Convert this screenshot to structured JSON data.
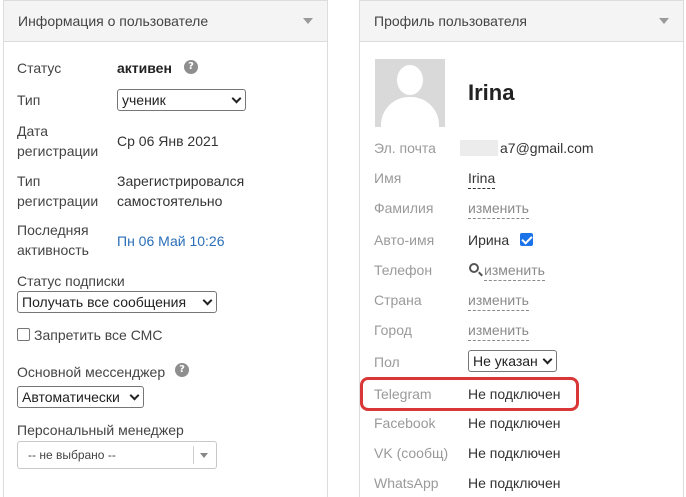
{
  "user_info": {
    "title": "Информация о пользователе",
    "status_label": "Статус",
    "status_value": "активен",
    "type_label": "Тип",
    "type_value": "ученик",
    "reg_date_label_1": "Дата",
    "reg_date_label_2": "регистрации",
    "reg_date_value": "Ср 06 Янв 2021",
    "reg_type_label_1": "Тип",
    "reg_type_label_2": "регистрации",
    "reg_type_value_1": "Зарегистрировался",
    "reg_type_value_2": "самостоятельно",
    "last_activity_label_1": "Последняя",
    "last_activity_label_2": "активность",
    "last_activity_value": "Пн 06 Май 10:26",
    "subscription_label": "Статус подписки",
    "subscription_value": "Получать все сообщения",
    "block_sms_label": "Запретить все СМС",
    "messenger_label": "Основной мессенджер",
    "messenger_value": "Автоматически",
    "manager_label": "Персональный менеджер",
    "manager_value": "-- не выбрано --"
  },
  "profile": {
    "title": "Профиль пользователя",
    "name": "Irina",
    "email_label": "Эл. почта",
    "email_value": "a7@gmail.com",
    "first_name_label": "Имя",
    "first_name_value": "Irina",
    "last_name_label": "Фамилия",
    "last_name_value": "изменить",
    "auto_name_label": "Авто-имя",
    "auto_name_value": "Ирина",
    "phone_label": "Телефон",
    "phone_value": "изменить",
    "country_label": "Страна",
    "country_value": "изменить",
    "city_label": "Город",
    "city_value": "изменить",
    "gender_label": "Пол",
    "gender_value": "Не указан",
    "telegram_label": "Telegram",
    "telegram_value": "Не подключен",
    "facebook_label": "Facebook",
    "facebook_value": "Не подключен",
    "vk_label": "VK (сообщ)",
    "vk_value": "Не подключен",
    "whatsapp_label": "WhatsApp",
    "whatsapp_value": "Не подключен"
  },
  "colors": {
    "link": "#2a6fb8",
    "highlight": "#d93737",
    "checkbox_accent": "#1a73e8"
  }
}
